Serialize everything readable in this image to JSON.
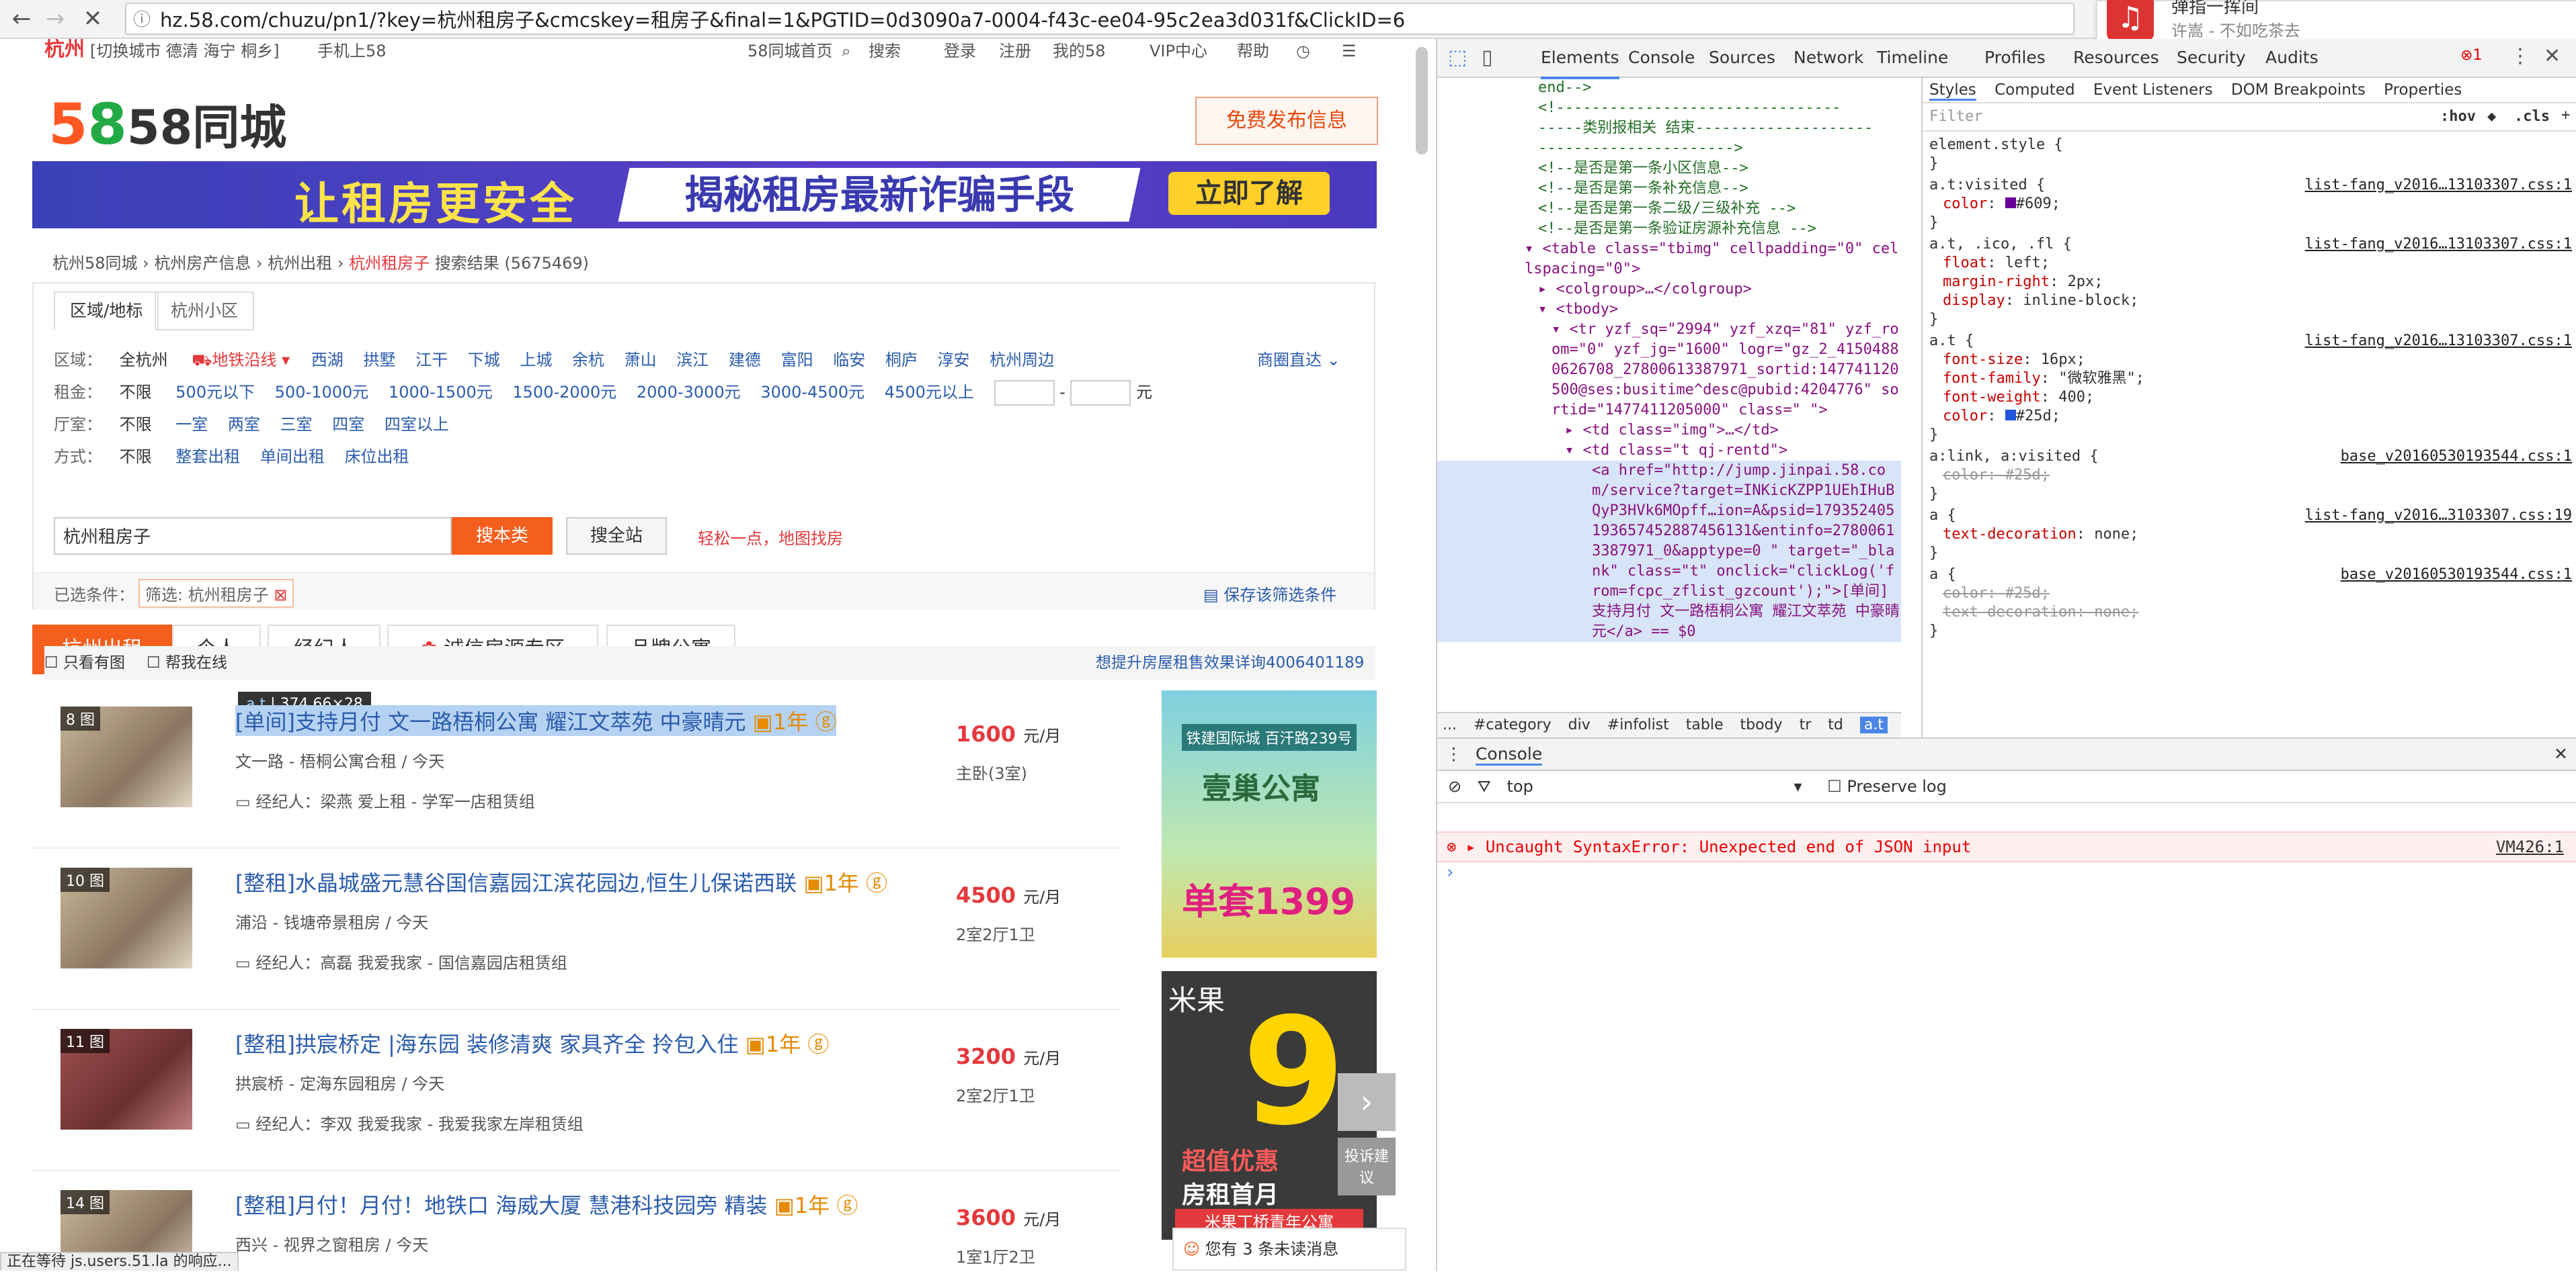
{
  "browser": {
    "url": "hz.58.com/chuzu/pn1/?key=杭州租房子&cmcskey=租房子&final=1&PGTID=0d3090a7-0004-f43c-ee04-95c2ea3d031f&ClickID=6",
    "notification_title": "弹指一挥间",
    "notification_sub": "许嵩 - 不如吃茶去",
    "status_bar": "正在等待 js.users.51.la 的响应..."
  },
  "topbar": {
    "city": "杭州",
    "city_links": "[切换城市 德清 海宁 桐乡]",
    "mobile": "手机上58",
    "links": [
      "58同城首页",
      "搜索",
      "登录",
      "注册",
      "我的58",
      "VIP中心",
      "帮助"
    ]
  },
  "header": {
    "logo": "58同城",
    "post_button": "免费发布信息",
    "banner_left": "让租房更安全",
    "banner_mid": "揭秘租房最新诈骗手段",
    "banner_btn": "立即了解"
  },
  "breadcrumb": {
    "items": [
      "杭州58同城",
      "杭州房产信息",
      "杭州出租",
      "杭州租房子"
    ],
    "results": "搜索结果 (5675469)"
  },
  "filter": {
    "tab_area": "区域/地标",
    "tab_community": "杭州小区",
    "area_label": "区域：",
    "area_all": "全杭州",
    "area_metro": "地铁沿线",
    "areas": [
      "西湖",
      "拱墅",
      "江干",
      "下城",
      "上城",
      "余杭",
      "萧山",
      "滨江",
      "建德",
      "富阳",
      "临安",
      "桐庐",
      "淳安",
      "杭州周边"
    ],
    "area_right": "商圈直达",
    "rent_label": "租金：",
    "rent_all": "不限",
    "rents": [
      "500元以下",
      "500-1000元",
      "1000-1500元",
      "1500-2000元",
      "2000-3000元",
      "3000-4500元",
      "4500元以上"
    ],
    "rent_unit": "元",
    "room_label": "厅室：",
    "room_all": "不限",
    "rooms": [
      "一室",
      "两室",
      "三室",
      "四室",
      "四室以上"
    ],
    "way_label": "方式：",
    "way_all": "不限",
    "ways": [
      "整套出租",
      "单间出租",
      "床位出租"
    ],
    "search_value": "杭州租房子",
    "search_cat": "搜本类",
    "search_site": "搜全站",
    "map_hint": "轻松一点，地图找房",
    "selected_label": "已选条件：",
    "selected_value": "筛选: 杭州租房子",
    "save_filter": "保存该筛选条件"
  },
  "tabs": [
    "杭州出租",
    "个人",
    "经纪人",
    "诚信房源专区",
    "品牌公寓"
  ],
  "list_opts": {
    "only_pic": "只看有图",
    "help_online": "帮我在线",
    "tooltip_tag": "a.t",
    "tooltip_size": "374.66×28",
    "promo": "想提升房屋租售效果详询4006401189"
  },
  "listings": [
    {
      "count": "8 图",
      "title": "[单间]支持月付 文一路梧桐公寓 耀江文萃苑 中豪晴元",
      "sub": "文一路 - 梧桐公寓合租 / 今天",
      "agent": "经纪人：梁燕  爱上租 - 学军一店租赁组",
      "price": "1600",
      "unit": "元/月",
      "room": "主卧(3室)"
    },
    {
      "count": "10 图",
      "title": "[整租]水晶城盛元慧谷国信嘉园江滨花园边,恒生儿保诺西联",
      "sub": "浦沿 - 钱塘帝景租房 / 今天",
      "agent": "经纪人：高磊  我爱我家 - 国信嘉园店租赁组",
      "price": "4500",
      "unit": "元/月",
      "room": "2室2厅1卫"
    },
    {
      "count": "11 图",
      "title": "[整租]拱宸桥定 |海东园 装修清爽 家具齐全 拎包入住",
      "sub": "拱宸桥 - 定海东园租房 / 今天",
      "agent": "经纪人：李双  我爱我家 - 我爱我家左岸租赁组",
      "price": "3200",
      "unit": "元/月",
      "room": "2室2厅1卫"
    },
    {
      "count": "14 图",
      "title": "[整租]月付！月付！地铁口 海威大厦 慧港科技园旁 精装",
      "sub": "西兴 - 视界之窗租房 / 今天",
      "agent": "",
      "price": "3600",
      "unit": "元/月",
      "room": "1室1厅2卫"
    }
  ],
  "ads": {
    "ad1_top": "铁建国际城 百汗路239号",
    "ad1_name": "壹巢公寓",
    "ad1_price": "单套1399",
    "ad2_brand": "米果",
    "ad2_big": "9",
    "ad2_line1": "超值优惠",
    "ad2_line2": "房租首月",
    "ad2_bottom": "米果丁桥青年公寓",
    "complaint": "投诉建议",
    "unread": "您有 3 条未读消息"
  },
  "devtools": {
    "tabs": [
      "Elements",
      "Console",
      "Sources",
      "Network",
      "Timeline",
      "Profiles",
      "Resources",
      "Security",
      "Audits"
    ],
    "error_count": "1",
    "style_tabs": [
      "Styles",
      "Computed",
      "Event Listeners",
      "DOM Breakpoints",
      "Properties"
    ],
    "filter_placeholder": "Filter",
    "hov": ":hov",
    "cls": ".cls",
    "dom_lines": [
      "end-->",
      "<!--------------------------------",
      "-----类别报相关 结束--------------------",
      "---------------------->",
      "<!--是否是第一条小区信息-->",
      "<!--是否是第一条补充信息-->",
      "<!--是否是第一条二级/三级补充 -->",
      "<!--是否是第一条验证房源补充信息 -->"
    ],
    "table_line": "<table class=\"tbimg\" cellpadding=\"0\" cellspacing=\"0\">",
    "colgroup": "<colgroup>…</colgroup>",
    "tbody": "<tbody>",
    "tr_line": "<tr yzf_sq=\"2994\" yzf_xzq=\"81\" yzf_room=\"0\" yzf_jg=\"1600\" logr=\"gz_2_41504880626708_27800613387971_sortid:147741120500@ses:busitime^desc@pubid:4204776\" sortid=\"1477411205000\" class=\" \">",
    "td_img": "<td class=\"img\">…</td>",
    "td_t": "<td class=\"t qj-rentd\">",
    "a_line": "<a href=\"http://jump.jinpai.58.com/service?target=INKicKZPP1UEhIHuBQyP3HVk6MOpff…ion=A&psid=179352405193657452887456131&entinfo=27800613387971_0&apptype=0 \" target=\"_blank\" class=\"t\" onclick=\"clickLog('from=fcpc_zflist_gzcount');\">[单间]支持月付 文一路梧桐公寓 耀江文萃苑 中豪晴元</a> == $0",
    "crumbs": [
      "...",
      "#category",
      "div",
      "#infolist",
      "table",
      "tbody",
      "tr",
      "td",
      "a.t"
    ],
    "styles": [
      {
        "sel": "element.style {",
        "src": "",
        "props": []
      },
      {
        "sel": "a.t:visited {",
        "src": "list-fang_v2016…13103307.css:1",
        "props": [
          [
            "color",
            "#609;"
          ]
        ]
      },
      {
        "sel": "a.t, .ico, .fl {",
        "src": "list-fang_v2016…13103307.css:1",
        "props": [
          [
            "float",
            "left;"
          ],
          [
            "margin-right",
            "2px;"
          ],
          [
            "display",
            "inline-block;"
          ]
        ]
      },
      {
        "sel": "a.t {",
        "src": "list-fang_v2016…13103307.css:1",
        "props": [
          [
            "font-size",
            "16px;"
          ],
          [
            "font-family",
            "\"微软雅黑\";"
          ],
          [
            "font-weight",
            "400;"
          ],
          [
            "color",
            "#25d;"
          ]
        ]
      },
      {
        "sel": "a:link, a:visited {",
        "src": "base_v20160530193544.css:1",
        "props": [
          [
            "color",
            "#25d;"
          ]
        ]
      },
      {
        "sel": "a {",
        "src": "list-fang_v2016…3103307.css:19",
        "props": [
          [
            "text-decoration",
            "none;"
          ]
        ]
      },
      {
        "sel": "a {",
        "src": "base_v20160530193544.css:1",
        "props": [
          [
            "color",
            "#25d;"
          ],
          [
            "text-decoration",
            "none;"
          ]
        ]
      }
    ],
    "console_label": "Console",
    "context": "top",
    "preserve_log": "Preserve log",
    "error_msg": "Uncaught SyntaxError: Unexpected end of JSON input",
    "error_src": "VM426:1"
  }
}
